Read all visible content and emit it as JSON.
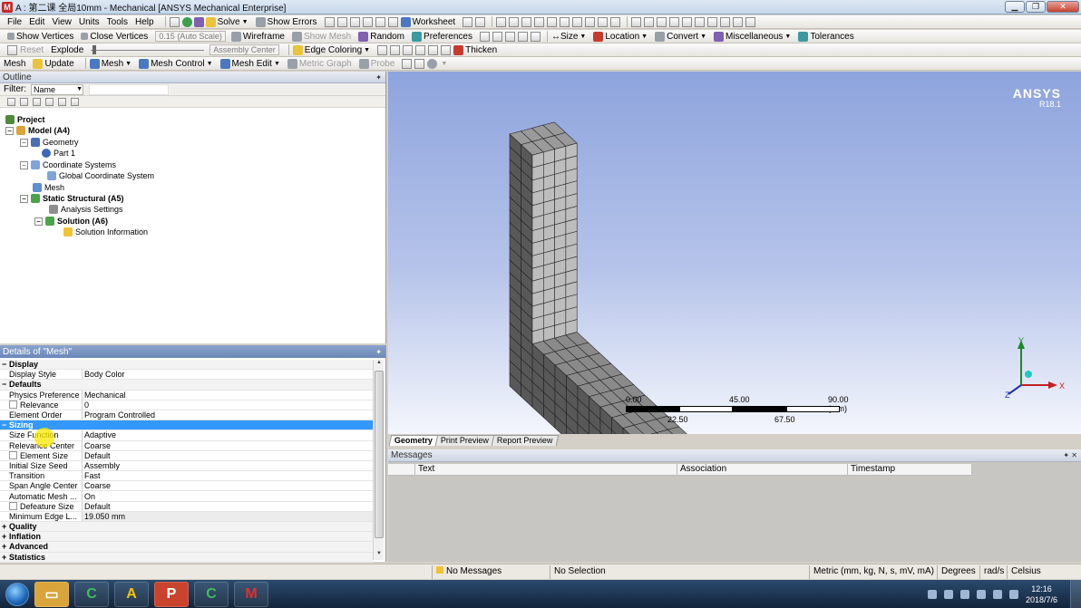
{
  "window": {
    "title": "A : 第二课 全局10mm - Mechanical [ANSYS Mechanical Enterprise]",
    "logo": "M",
    "buttons": {
      "minimize": "▁",
      "maximize": "❐",
      "close": "✕"
    }
  },
  "menubar": {
    "items": [
      "File",
      "Edit",
      "View",
      "Units",
      "Tools",
      "Help"
    ],
    "solve": "Solve",
    "show_errors": "Show Errors",
    "worksheet": "Worksheet"
  },
  "toolbar2": {
    "show_vertices": "Show Vertices",
    "close_vertices": "Close Vertices",
    "scale_value": "0.15 (Auto Scale)",
    "wireframe": "Wireframe",
    "show_mesh": "Show Mesh",
    "random": "Random",
    "preferences": "Preferences",
    "size": "Size",
    "location": "Location",
    "convert": "Convert",
    "miscellaneous": "Miscellaneous",
    "tolerances": "Tolerances"
  },
  "toolbar3": {
    "reset": "Reset",
    "explode": "Explode",
    "assembly_center": "Assembly Center",
    "edge_coloring": "Edge Coloring",
    "thicken": "Thicken"
  },
  "toolbar4": {
    "mesh": "Mesh",
    "update": "Update",
    "mesh_dd": "Mesh",
    "mesh_control": "Mesh Control",
    "mesh_edit": "Mesh Edit",
    "metric_graph": "Metric Graph",
    "probe": "Probe"
  },
  "outline": {
    "title": "Outline",
    "filter_label": "Filter:",
    "filter_value": "Name",
    "tree": {
      "project": "Project",
      "model": "Model (A4)",
      "geometry": "Geometry",
      "part": "Part 1",
      "coordinate_systems": "Coordinate Systems",
      "global_cs": "Global Coordinate System",
      "mesh": "Mesh",
      "static_structural": "Static Structural (A5)",
      "analysis_settings": "Analysis Settings",
      "solution": "Solution (A6)",
      "solution_info": "Solution Information"
    }
  },
  "details": {
    "title": "Details of \"Mesh\"",
    "rows": [
      {
        "type": "cat",
        "key": "Display",
        "sign": "−"
      },
      {
        "type": "row",
        "key": "Display Style",
        "value": "Body Color"
      },
      {
        "type": "cat",
        "key": "Defaults",
        "sign": "−"
      },
      {
        "type": "row",
        "key": "Physics Preference",
        "value": "Mechanical"
      },
      {
        "type": "check",
        "key": "Relevance",
        "value": "0"
      },
      {
        "type": "row",
        "key": "Element Order",
        "value": "Program Controlled"
      },
      {
        "type": "cat-selected",
        "key": "Sizing",
        "sign": "−"
      },
      {
        "type": "row",
        "key": "Size Function",
        "value": "Adaptive"
      },
      {
        "type": "row",
        "key": "Relevance Center",
        "value": "Coarse"
      },
      {
        "type": "check",
        "key": "Element Size",
        "value": "Default"
      },
      {
        "type": "row",
        "key": "Initial Size Seed",
        "value": "Assembly"
      },
      {
        "type": "row",
        "key": "Transition",
        "value": "Fast"
      },
      {
        "type": "row",
        "key": "Span Angle Center",
        "value": "Coarse"
      },
      {
        "type": "row",
        "key": "Automatic Mesh ...",
        "value": "On"
      },
      {
        "type": "check",
        "key": "Defeature Size",
        "value": "Default"
      },
      {
        "type": "shaded",
        "key": "Minimum Edge L...",
        "value": "19.050 mm"
      },
      {
        "type": "cat",
        "key": "Quality",
        "sign": "+"
      },
      {
        "type": "cat",
        "key": "Inflation",
        "sign": "+"
      },
      {
        "type": "cat",
        "key": "Advanced",
        "sign": "+"
      },
      {
        "type": "cat",
        "key": "Statistics",
        "sign": "+"
      }
    ]
  },
  "viewport": {
    "brand": "ANSYS",
    "version": "R18.1",
    "scale": {
      "v0": "0.00",
      "v1": "22.50",
      "v2": "45.00",
      "v3": "67.50",
      "v4": "90.00 (mm)"
    },
    "axes": {
      "x": "X",
      "y": "Y",
      "z": "Z"
    }
  },
  "view_tabs": [
    "Geometry",
    "Print Preview",
    "Report Preview"
  ],
  "messages": {
    "title": "Messages",
    "columns": [
      "Text",
      "Association",
      "Timestamp"
    ]
  },
  "statusbar": {
    "messages": "No Messages",
    "selection": "No Selection",
    "units": "Metric (mm, kg, N, s, mV, mA)",
    "angle": "Degrees",
    "angular_velocity": "rad/s",
    "temperature": "Celsius"
  },
  "taskbar": {
    "time": "12:16",
    "date": "2018/7/6",
    "apps": [
      "C",
      "A",
      "P",
      "C",
      "M"
    ]
  },
  "colors": {
    "accent": "#3399ff",
    "mesh_light": "#bdbdbd",
    "mesh_dark": "#585858"
  }
}
